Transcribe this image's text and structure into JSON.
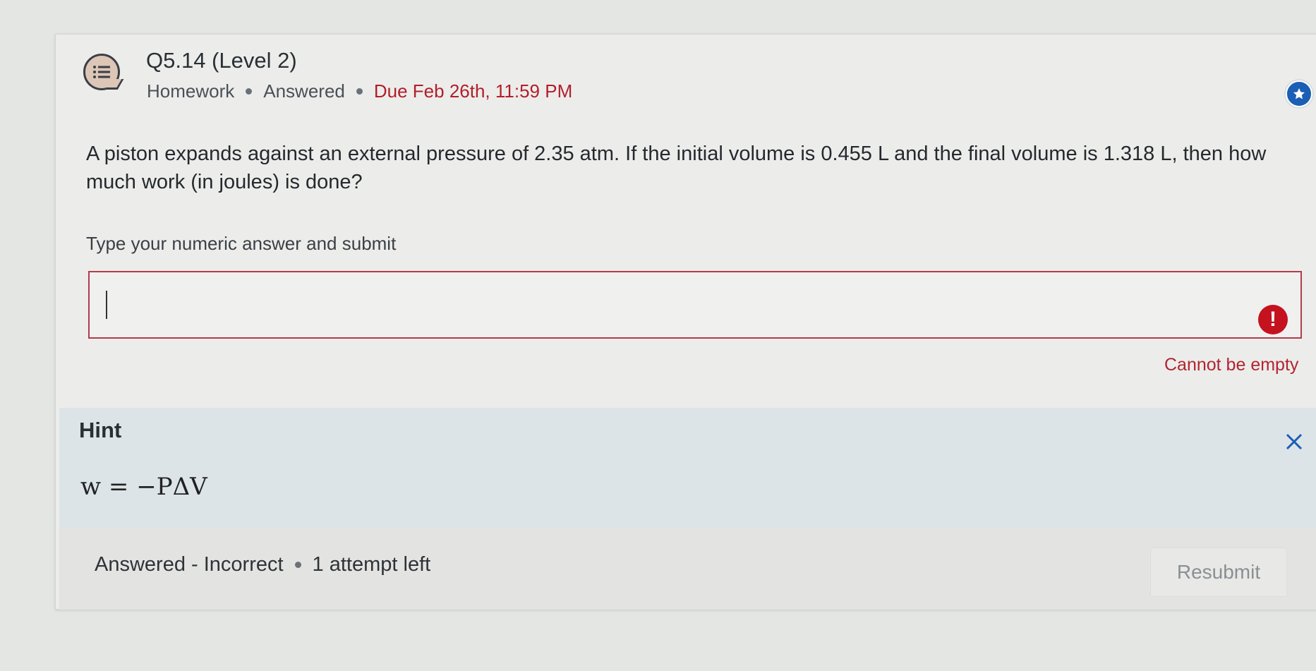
{
  "question": {
    "title": "Q5.14 (Level 2)",
    "meta": {
      "type": "Homework",
      "status": "Answered",
      "due": "Due Feb 26th, 11:59 PM"
    },
    "text": "A piston expands against an external pressure of 2.35 atm. If the initial volume is 0.455 L and the final volume is 1.318 L, then how much work (in joules) is done?",
    "instruction": "Type your numeric answer and submit"
  },
  "answer": {
    "value": "",
    "error": "Cannot be empty"
  },
  "hint": {
    "title": "Hint",
    "formula": "w = −PΔV"
  },
  "footer": {
    "result": "Answered - Incorrect",
    "attempts": "1 attempt left",
    "resubmit_label": "Resubmit"
  },
  "colors": {
    "due": "#b21e2a",
    "error": "#c4121f",
    "star": "#1a5fb4",
    "hint_bg": "#dde4e8"
  },
  "icons": {
    "question": "list-bubble-icon",
    "star": "star-icon",
    "error": "exclamation-icon",
    "close": "close-icon"
  }
}
